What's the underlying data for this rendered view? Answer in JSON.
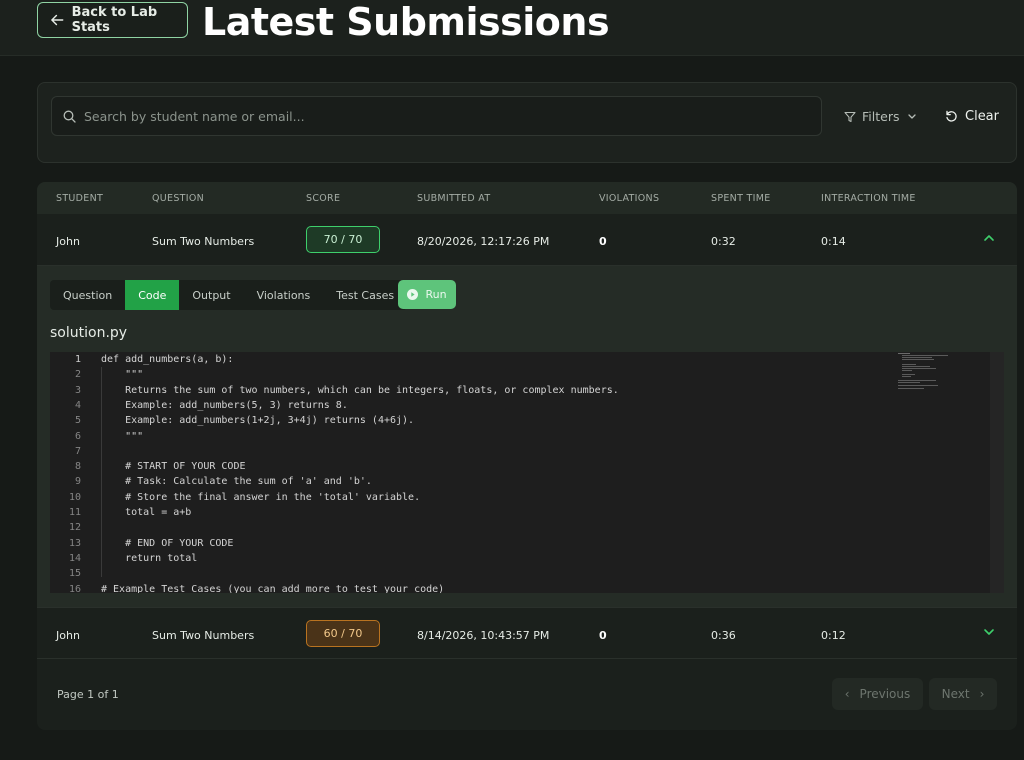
{
  "header": {
    "back_label": "Back to Lab Stats",
    "title": "Latest Submissions"
  },
  "search": {
    "placeholder": "Search by student name or email...",
    "value": "",
    "filters_label": "Filters",
    "clear_label": "Clear"
  },
  "table": {
    "columns": [
      "STUDENT",
      "QUESTION",
      "SCORE",
      "SUBMITTED AT",
      "VIOLATIONS",
      "SPENT TIME",
      "INTERACTION TIME"
    ],
    "rows": [
      {
        "student": "John",
        "question": "Sum Two Numbers",
        "score": "70 / 70",
        "submitted_at": "8/20/2026, 12:17:26 PM",
        "violations": "0",
        "spent_time": "0:32",
        "interaction_time": "0:14",
        "expanded": true,
        "score_color": "#3ecf6b"
      },
      {
        "student": "John",
        "question": "Sum Two Numbers",
        "score": "60 / 70",
        "submitted_at": "8/14/2026, 10:43:57 PM",
        "violations": "0",
        "spent_time": "0:36",
        "interaction_time": "0:12",
        "expanded": false,
        "score_color": "#b97320"
      }
    ]
  },
  "detail": {
    "tabs": [
      "Question",
      "Code",
      "Output",
      "Violations",
      "Test Cases"
    ],
    "active_tab": "Code",
    "run_label": "Run",
    "file_name": "solution.py",
    "code_lines": [
      {
        "n": "1",
        "text": "def add_numbers(a, b):"
      },
      {
        "n": "2",
        "text": "    \"\"\""
      },
      {
        "n": "3",
        "text": "    Returns the sum of two numbers, which can be integers, floats, or complex numbers."
      },
      {
        "n": "4",
        "text": "    Example: add_numbers(5, 3) returns 8."
      },
      {
        "n": "5",
        "text": "    Example: add_numbers(1+2j, 3+4j) returns (4+6j)."
      },
      {
        "n": "6",
        "text": "    \"\"\""
      },
      {
        "n": "7",
        "text": ""
      },
      {
        "n": "8",
        "text": "    # START OF YOUR CODE"
      },
      {
        "n": "9",
        "text": "    # Task: Calculate the sum of 'a' and 'b'."
      },
      {
        "n": "10",
        "text": "    # Store the final answer in the 'total' variable."
      },
      {
        "n": "11",
        "text": "    total = a+b"
      },
      {
        "n": "12",
        "text": ""
      },
      {
        "n": "13",
        "text": "    # END OF YOUR CODE"
      },
      {
        "n": "14",
        "text": "    return total"
      },
      {
        "n": "15",
        "text": ""
      },
      {
        "n": "16",
        "text": "# Example Test Cases (you can add more to test your code)"
      }
    ]
  },
  "pagination": {
    "page_text": "Page 1 of 1",
    "previous_label": "Previous",
    "next_label": "Next"
  },
  "colors": {
    "accent_green": "#22a247",
    "run_green": "#5ec47b",
    "background": "#161a17"
  }
}
